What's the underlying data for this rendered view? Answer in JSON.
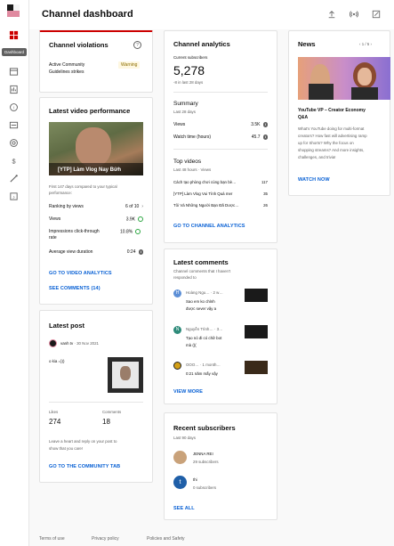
{
  "sidebar": {
    "tooltip": "Dashboard",
    "icons": [
      "dashboard-icon",
      "content-icon",
      "analytics-icon",
      "comments-icon",
      "subtitles-icon",
      "copyright-icon",
      "earn-icon",
      "customization-icon",
      "audio-library-icon"
    ]
  },
  "header": {
    "title": "Channel dashboard",
    "icons": [
      "upload-icon",
      "live-icon",
      "create-post-icon"
    ]
  },
  "violations": {
    "title": "Channel violations",
    "item_label_1": "Active Community",
    "item_label_2": "Guidelines strikes",
    "status": "Warning"
  },
  "video_performance": {
    "title": "Latest video performance",
    "thumbnail_caption": "[YTP] Làm Vlog Nay Bửh",
    "compare_text_1": "First 147 days compared to your typical",
    "compare_text_2": "performance:",
    "metrics": [
      {
        "label": "Ranking by views",
        "value": "6 of 10"
      },
      {
        "label": "Views",
        "value": "3.9K"
      },
      {
        "label_1": "Impressions click-through",
        "label_2": "rate",
        "value": "10.8%"
      },
      {
        "label": "Average view duration",
        "value": "0:24"
      }
    ],
    "link_analytics": "GO TO VIDEO ANALYTICS",
    "link_comments": "SEE COMMENTS (14)"
  },
  "latest_post": {
    "title": "Latest post",
    "author": "vanh tv",
    "date": "30 Nov 2021",
    "text": "o kia =)))",
    "likes_label": "Likes",
    "likes_value": "274",
    "comments_label": "Comments",
    "comments_value": "18",
    "prompt_1": "Leave a heart and reply on your post to",
    "prompt_2": "show that you care!",
    "link": "GO TO THE COMMUNITY TAB"
  },
  "analytics": {
    "title": "Channel analytics",
    "subs_label": "Current subscribers",
    "subs_value": "5,278",
    "subs_change": "-8 in last 28 days",
    "summary_title": "Summary",
    "summary_period": "Last 28 days",
    "summary_rows": [
      {
        "label": "Views",
        "value": "3.5K"
      },
      {
        "label": "Watch time (hours)",
        "value": "45.7"
      }
    ],
    "top_title": "Top videos",
    "top_period": "Last 48 hours · Views",
    "top_rows": [
      {
        "label": "Cách tạo phòng chơi cùng bạn bè…",
        "value": "117"
      },
      {
        "label": "[YTP] Làm Vlog Vui Tính Quá mer",
        "value": "35"
      },
      {
        "label": "Tôi Và Những Người Bạn Đã Dược…",
        "value": "26"
      }
    ],
    "link": "GO TO CHANNEL ANALYTICS"
  },
  "comments": {
    "title": "Latest comments",
    "subtitle_1": "Channel comments that I haven't",
    "subtitle_2": "responded to",
    "items": [
      {
        "initial": "H",
        "name": "Hoàng Ngu…",
        "time": "· 2 w…",
        "text_1": "Sao em ko chỉnh",
        "text_2": "được sever vậy a",
        "color": "#5c8fd6"
      },
      {
        "initial": "N",
        "name": "Nguyễn Trình…",
        "time": "· 3…",
        "text_1": "Tạo nó đi có chữ bot",
        "text_2": "mà (((",
        "color": "#2e8b7a"
      },
      {
        "initial": "",
        "name": "OOO…",
        "time": "· 1 month…",
        "text_1": "0:21 năm mấy vậy",
        "text_2": "",
        "color": "#d4a017"
      }
    ],
    "link": "VIEW MORE"
  },
  "subscribers": {
    "title": "Recent subscribers",
    "period": "Last 90 days",
    "items": [
      {
        "initial": "",
        "name": "JENNA REI",
        "count": "29 subscribers",
        "color": "#c9a27a"
      },
      {
        "initial": "t",
        "name": "thi",
        "count": "0 subscribers",
        "color": "#1f5fa8"
      }
    ],
    "link": "SEE ALL"
  },
  "news": {
    "title": "News",
    "pager": "1 / 5",
    "headline_1": "YouTube VP – Creator Economy",
    "headline_2": "Q&A",
    "body_1": "What's YouTube doing for multi-format",
    "body_2": "creators? How fast will advertising ramp",
    "body_3": "up for Shorts? Why the focus on",
    "body_4": "shopping streams? And more insights,",
    "body_5": "challenges, and trivia!",
    "link": "WATCH NOW"
  },
  "footer": {
    "links": [
      "Terms of use",
      "Privacy policy",
      "Policies and Safety"
    ]
  },
  "colors": {
    "accent_red": "#cc0000",
    "link_blue": "#065fd4",
    "warning_bg": "#fef7e0",
    "success_green": "#2ba640"
  }
}
